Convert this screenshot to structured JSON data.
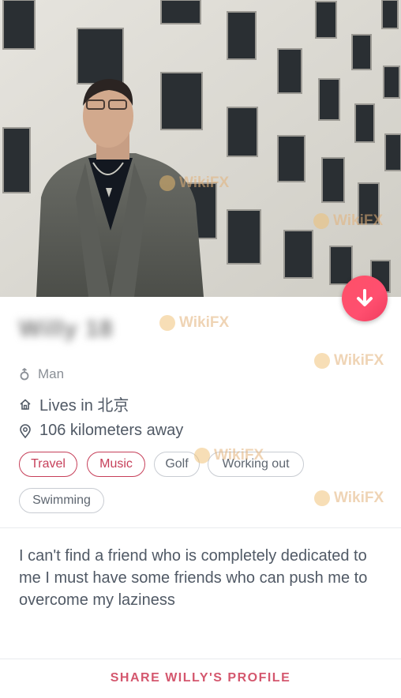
{
  "profile": {
    "name": "Willy 18",
    "gender": "Man",
    "lives_in": "Lives in 北京",
    "distance": "106 kilometers away",
    "bio": "I can't find a friend who is completely dedicated to me I must have some friends who can push me to overcome my laziness",
    "share_label": "SHARE WILLY'S PROFILE"
  },
  "interests": [
    {
      "label": "Travel",
      "shared": true
    },
    {
      "label": "Music",
      "shared": true
    },
    {
      "label": "Golf",
      "shared": false
    },
    {
      "label": "Working out",
      "shared": false
    },
    {
      "label": "Swimming",
      "shared": false
    }
  ],
  "watermark": "WikiFX",
  "icons": {
    "fab": "arrow-down-icon",
    "gender": "gender-icon",
    "home": "home-icon",
    "location": "location-pin-icon"
  },
  "colors": {
    "accent": "#fd5068",
    "chip_active": "#c63f59",
    "share": "#d4576e",
    "text": "#505965"
  }
}
